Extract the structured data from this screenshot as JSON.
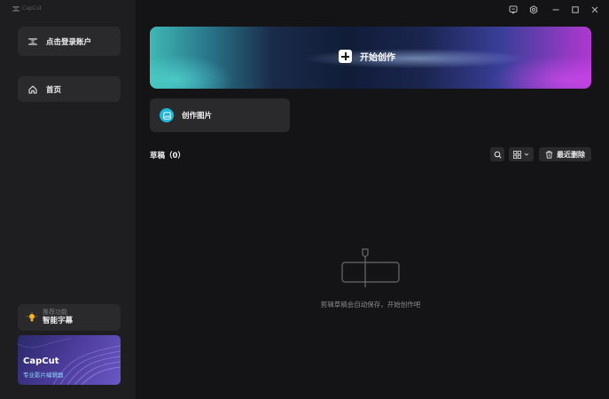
{
  "app": {
    "brand": "CapCut"
  },
  "window": {
    "icons": [
      "feedback-icon",
      "settings-icon",
      "minimize-icon",
      "maximize-icon",
      "close-icon"
    ]
  },
  "sidebar": {
    "login_label": "点击登录账户",
    "nav": [
      {
        "label": "首页",
        "icon": "home-icon",
        "active": true
      }
    ],
    "feature": {
      "sub": "推荐功能",
      "main": "智能字幕",
      "icon": "bulb-icon"
    },
    "promo": {
      "title": "CapCut",
      "subtitle": "专业影片编辑器"
    }
  },
  "main": {
    "hero_label": "开始创作",
    "create_image_label": "创作图片",
    "drafts": {
      "title": "草稿（0）",
      "trash_label": "最近删除",
      "empty_message": "剪辑草稿会自动保存，开始创作吧"
    }
  },
  "colors": {
    "accent_teal": "#1fb8d4",
    "sidebar_bg": "#1e1e20",
    "card_bg": "#2a2a2d",
    "page_bg": "#141416"
  }
}
